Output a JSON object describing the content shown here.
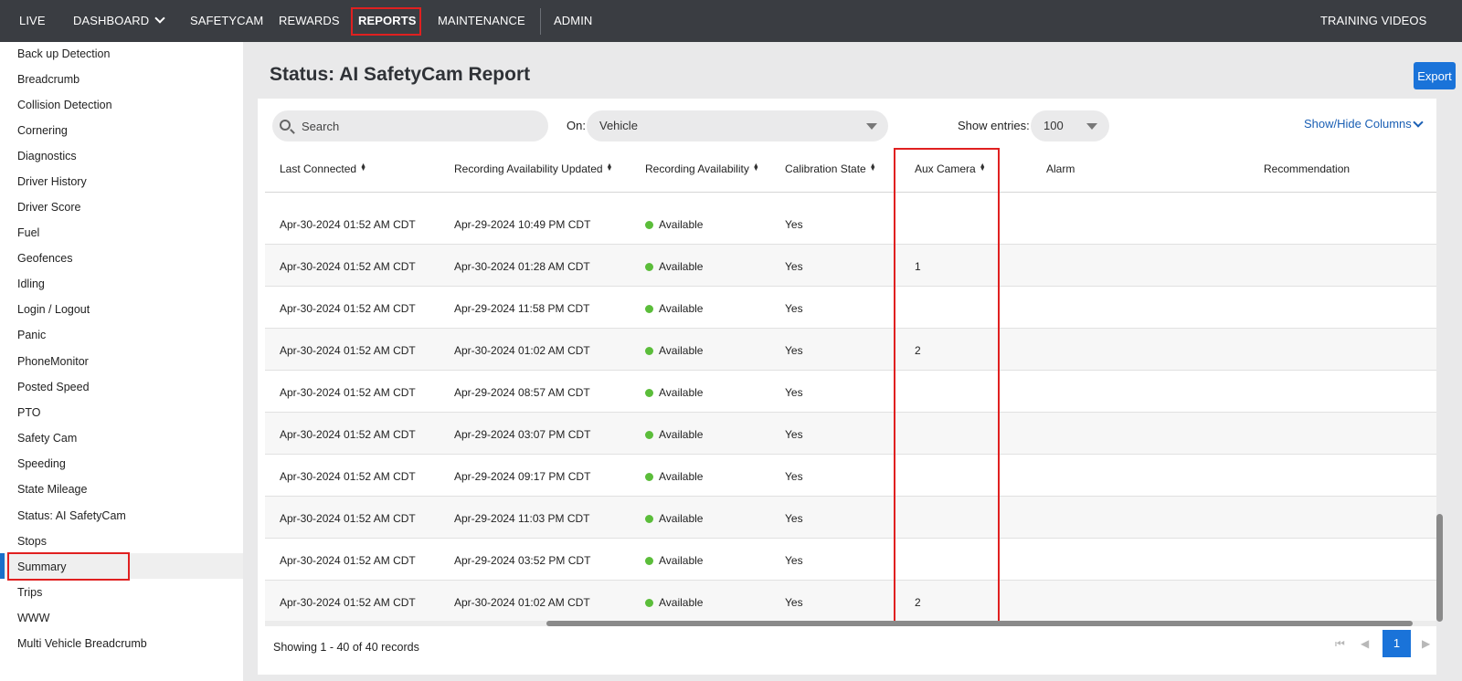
{
  "nav": {
    "items": [
      "LIVE",
      "DASHBOARD",
      "SAFETYCAM",
      "REWARDS",
      "REPORTS",
      "MAINTENANCE",
      "ADMIN"
    ],
    "right": "TRAINING VIDEOS",
    "active": "REPORTS"
  },
  "sidebar": {
    "items": [
      "Back up Detection",
      "Breadcrumb",
      "Collision Detection",
      "Cornering",
      "Diagnostics",
      "Driver History",
      "Driver Score",
      "Fuel",
      "Geofences",
      "Idling",
      "Login / Logout",
      "Panic",
      "PhoneMonitor",
      "Posted Speed",
      "PTO",
      "Safety Cam",
      "Speeding",
      "State Mileage",
      "Status: AI SafetyCam",
      "Stops",
      "Summary",
      "Trips",
      "WWW",
      "Multi Vehicle Breadcrumb"
    ],
    "active": "Status: AI SafetyCam"
  },
  "page": {
    "title": "Status: AI SafetyCam Report",
    "export_label": "Export"
  },
  "filters": {
    "search_placeholder": "Search",
    "on_label": "On:",
    "vehicle_value": "Vehicle",
    "entries_label": "Show entries:",
    "entries_value": "100",
    "showhide_label": "Show/Hide Columns"
  },
  "table": {
    "columns": [
      "Last Connected",
      "Recording Availability Updated",
      "Recording Availability",
      "Calibration State",
      "Aux Camera",
      "Alarm",
      "Recommendation"
    ],
    "rows": [
      [
        "Apr-30-2024 01:52 AM CDT",
        "Apr-29-2024 10:49 PM CDT",
        "Available",
        "Yes",
        "",
        "",
        ""
      ],
      [
        "Apr-30-2024 01:52 AM CDT",
        "Apr-30-2024 01:28 AM CDT",
        "Available",
        "Yes",
        "1",
        "",
        ""
      ],
      [
        "Apr-30-2024 01:52 AM CDT",
        "Apr-29-2024 11:58 PM CDT",
        "Available",
        "Yes",
        "",
        "",
        ""
      ],
      [
        "Apr-30-2024 01:52 AM CDT",
        "Apr-30-2024 01:02 AM CDT",
        "Available",
        "Yes",
        "2",
        "",
        ""
      ],
      [
        "Apr-30-2024 01:52 AM CDT",
        "Apr-29-2024 08:57 AM CDT",
        "Available",
        "Yes",
        "",
        "",
        ""
      ],
      [
        "Apr-30-2024 01:52 AM CDT",
        "Apr-29-2024 03:07 PM CDT",
        "Available",
        "Yes",
        "",
        "",
        ""
      ],
      [
        "Apr-30-2024 01:52 AM CDT",
        "Apr-29-2024 09:17 PM CDT",
        "Available",
        "Yes",
        "",
        "",
        ""
      ],
      [
        "Apr-30-2024 01:52 AM CDT",
        "Apr-29-2024 11:03 PM CDT",
        "Available",
        "Yes",
        "",
        "",
        ""
      ],
      [
        "Apr-30-2024 01:52 AM CDT",
        "Apr-29-2024 03:52 PM CDT",
        "Available",
        "Yes",
        "",
        "",
        ""
      ],
      [
        "Apr-30-2024 01:52 AM CDT",
        "Apr-30-2024 01:02 AM CDT",
        "Available",
        "Yes",
        "2",
        "",
        ""
      ]
    ],
    "status_color": "#5bbd3a"
  },
  "footer": {
    "records_text": "Showing 1 - 40 of 40 records",
    "current_page": "1"
  },
  "colors": {
    "nav_bg": "#3a3d42",
    "accent": "#1a73d9",
    "highlight": "#e02020"
  }
}
